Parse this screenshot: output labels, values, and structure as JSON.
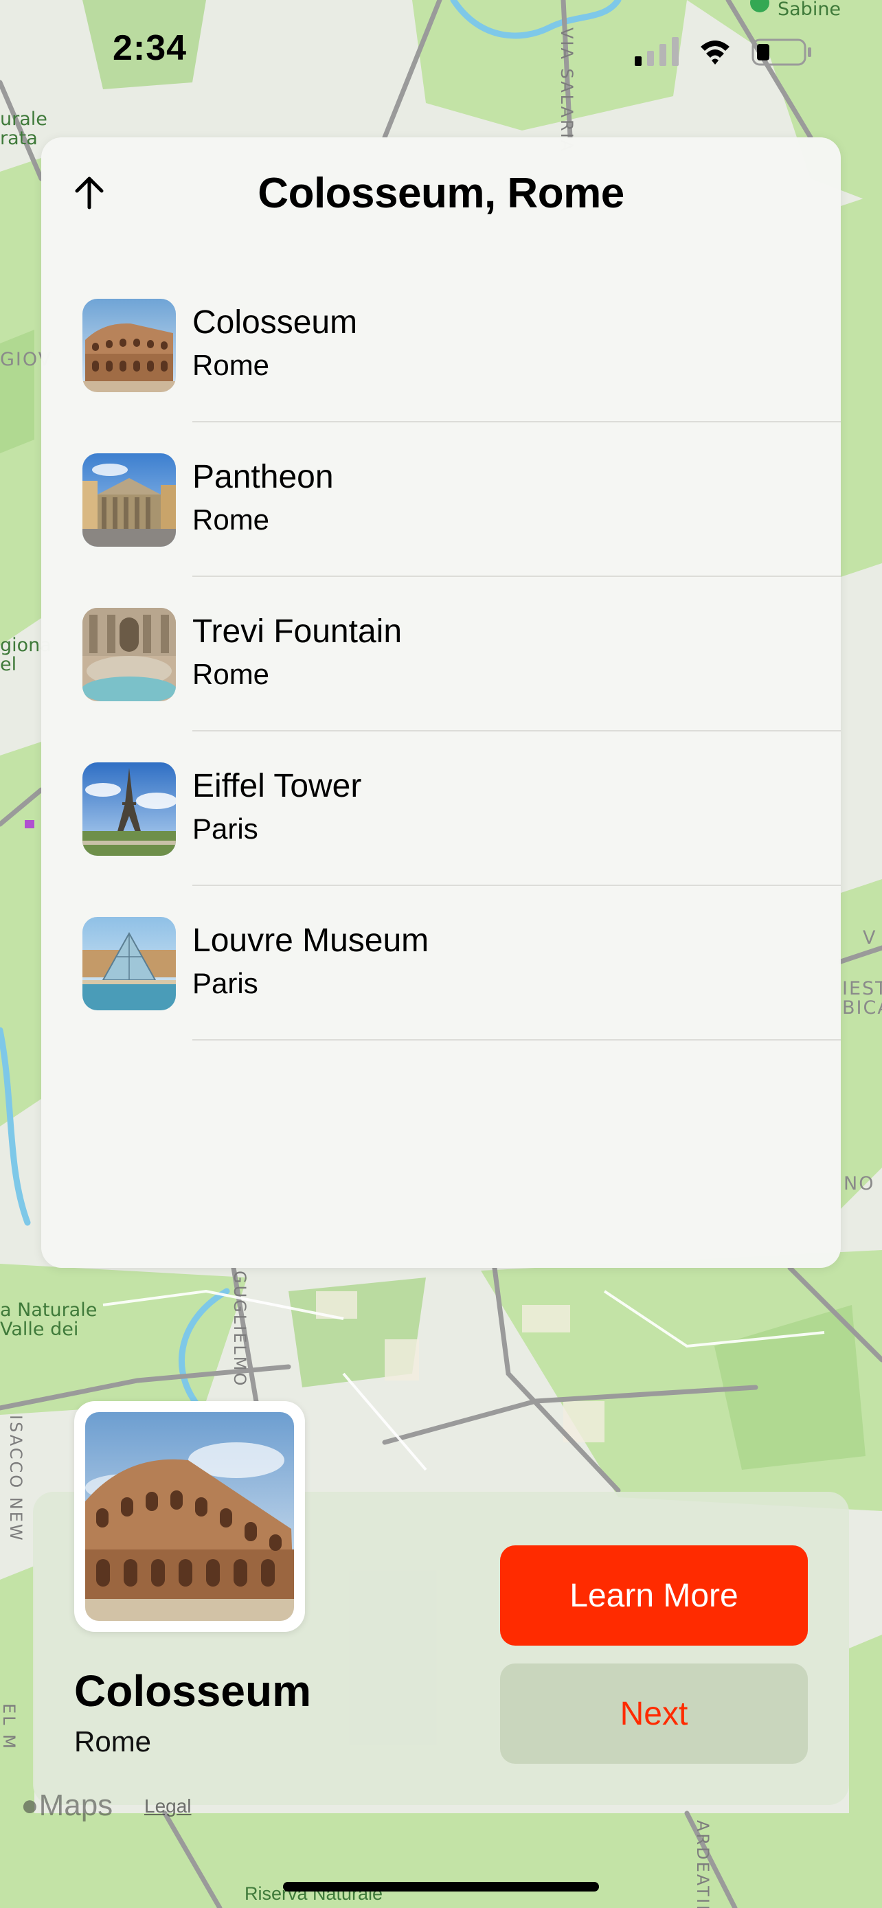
{
  "status_bar": {
    "time": "2:34"
  },
  "map": {
    "labels": {
      "sabine": "Sabine",
      "riserva_top_left": "urale\nrata",
      "via_salaria": "VIA SALARIA",
      "giov": "GIOV",
      "regional_left": "giona\nel",
      "riserva_valle": "a Naturale\nValle dei",
      "guglielmo": "GUGLIELMO",
      "isacco": "ISACCO NEW",
      "right_v": "V",
      "right_iest": "IEST\nBICA",
      "right_no": "NO",
      "left_el_m": "EL M",
      "ardeatina": "ARDEATINA",
      "riserva_bottom": "Riserva Naturale"
    },
    "footer": {
      "logo_text": "Maps",
      "legal_text": "Legal"
    }
  },
  "sheet": {
    "title": "Colosseum, Rome",
    "places": [
      {
        "name": "Colosseum",
        "city": "Rome",
        "thumb": "colosseum"
      },
      {
        "name": "Pantheon",
        "city": "Rome",
        "thumb": "pantheon"
      },
      {
        "name": "Trevi Fountain",
        "city": "Rome",
        "thumb": "trevi"
      },
      {
        "name": "Eiffel Tower",
        "city": "Paris",
        "thumb": "eiffel"
      },
      {
        "name": "Louvre Museum",
        "city": "Paris",
        "thumb": "louvre"
      }
    ]
  },
  "card": {
    "title": "Colosseum",
    "subtitle": "Rome",
    "learn_more_label": "Learn More",
    "next_label": "Next"
  },
  "colors": {
    "accent": "#ff2b00",
    "sheet_bg": "#f5f6f3",
    "card_bg": "#dee8d6",
    "map_land": "#e9ece4",
    "map_green": "#bfe0a0",
    "map_water": "#7ec8e8"
  }
}
